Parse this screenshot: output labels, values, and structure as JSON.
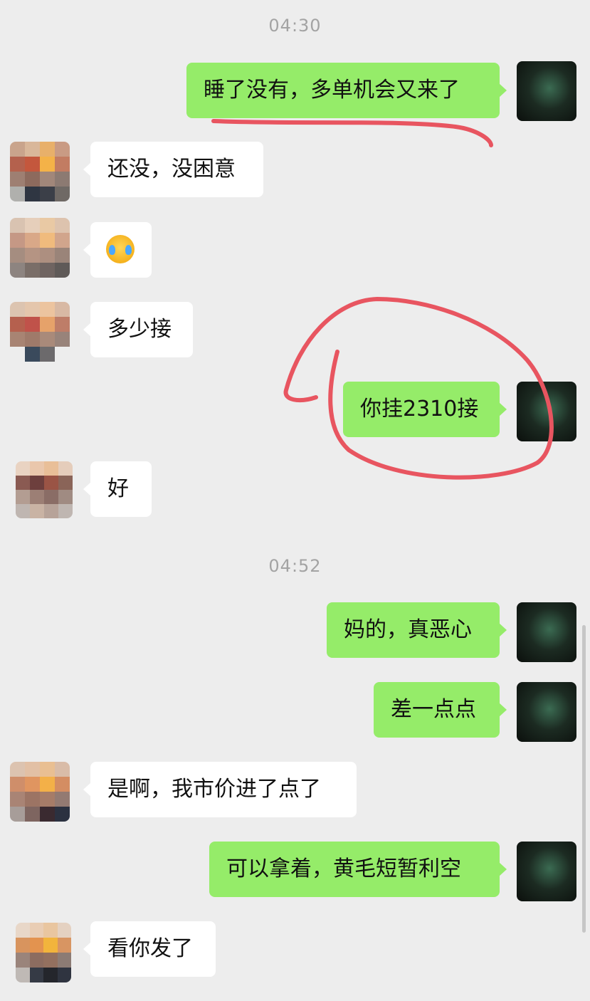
{
  "timestamps": [
    "04:30",
    "04:52"
  ],
  "messages": [
    {
      "side": "out",
      "text": "睡了没有，多单机会又来了"
    },
    {
      "side": "in",
      "text": "还没，没困意"
    },
    {
      "side": "in",
      "text": "",
      "emoji": "crying-laughing-emoji"
    },
    {
      "side": "in",
      "text": "多少接"
    },
    {
      "side": "out",
      "text": "你挂2310接"
    },
    {
      "side": "in",
      "text": "好"
    },
    {
      "side": "out",
      "text": "妈的，真恶心"
    },
    {
      "side": "out",
      "text": "差一点点"
    },
    {
      "side": "in",
      "text": "是啊，我市价进了点了"
    },
    {
      "side": "out",
      "text": "可以拿着，黄毛短暂利空"
    },
    {
      "side": "in",
      "text": "看你发了"
    }
  ],
  "colors": {
    "background": "#ededed",
    "outgoing_bubble": "#95ec69",
    "incoming_bubble": "#ffffff",
    "annotation": "#e85560"
  },
  "icons": {
    "my_avatar": "joker-avatar-icon",
    "contact_avatar": "pixelated-avatar-icon"
  }
}
